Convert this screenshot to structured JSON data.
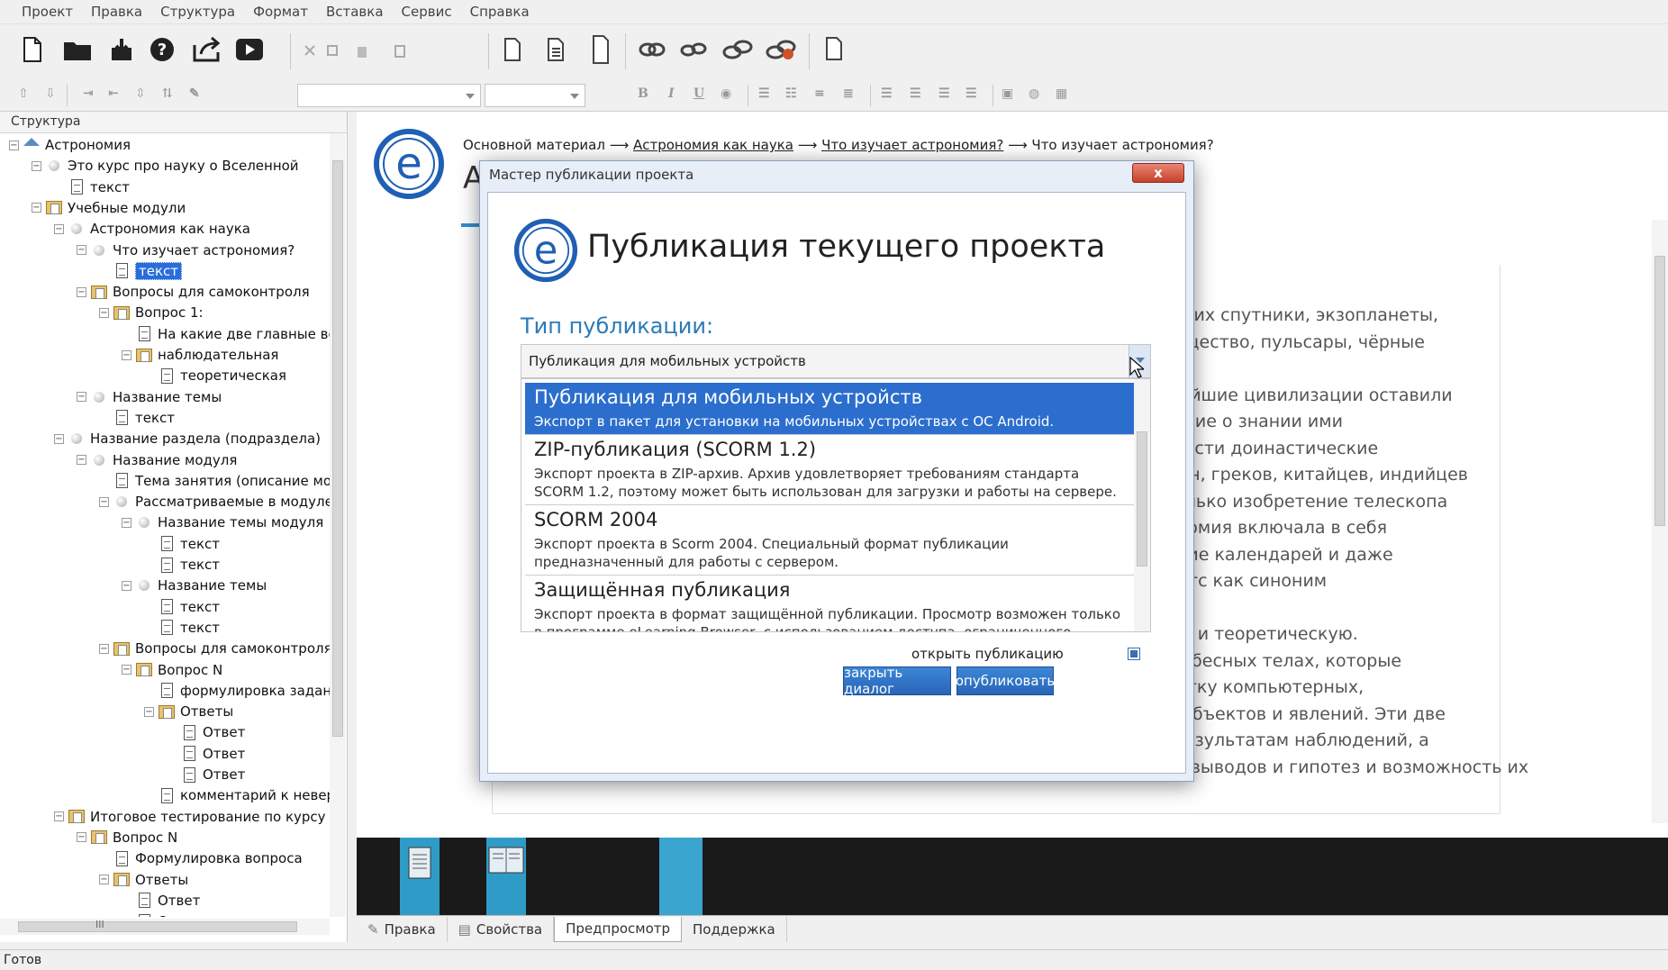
{
  "menu": [
    "Проект",
    "Правка",
    "Структура",
    "Формат",
    "Вставка",
    "Сервис",
    "Справка"
  ],
  "structure_panel": {
    "header": "Структура",
    "nodes": [
      {
        "label": "Астрономия",
        "depth": 0,
        "icon": "home-icon",
        "toggle": "−"
      },
      {
        "label": "Это курс про науку о Вселенной",
        "depth": 1,
        "icon": "circle-icon",
        "toggle": "−"
      },
      {
        "label": "текст",
        "depth": 2,
        "icon": "doc-icon",
        "toggle": ""
      },
      {
        "label": "Учебные модули",
        "depth": 1,
        "icon": "folder-icon",
        "toggle": "−"
      },
      {
        "label": "Астрономия как наука",
        "depth": 2,
        "icon": "circle-icon",
        "toggle": "−"
      },
      {
        "label": "Что изучает астрономия?",
        "depth": 3,
        "icon": "circle-icon",
        "toggle": "−"
      },
      {
        "label": "текст",
        "depth": 4,
        "icon": "doc-icon",
        "toggle": "",
        "selected": true
      },
      {
        "label": "Вопросы для самоконтроля",
        "depth": 3,
        "icon": "folder-icon",
        "toggle": "−"
      },
      {
        "label": "Вопрос 1:",
        "depth": 4,
        "icon": "folder-icon",
        "toggle": "−"
      },
      {
        "label": "На какие две главные ветв",
        "depth": 5,
        "icon": "doc-icon",
        "toggle": ""
      },
      {
        "label": "наблюдательная",
        "depth": 5,
        "icon": "folder-icon",
        "toggle": "−"
      },
      {
        "label": "теоретическая",
        "depth": 6,
        "icon": "doc-icon",
        "toggle": ""
      },
      {
        "label": "Название темы",
        "depth": 3,
        "icon": "circle-icon",
        "toggle": "−"
      },
      {
        "label": "текст",
        "depth": 4,
        "icon": "doc-icon",
        "toggle": ""
      },
      {
        "label": "Название раздела (подраздела)",
        "depth": 2,
        "icon": "circle-icon",
        "toggle": "−"
      },
      {
        "label": "Название модуля",
        "depth": 3,
        "icon": "circle-icon",
        "toggle": "−"
      },
      {
        "label": "Тема занятия (описание моду",
        "depth": 4,
        "icon": "doc-icon",
        "toggle": ""
      },
      {
        "label": "Рассматриваемые в модуле т",
        "depth": 4,
        "icon": "circle-icon",
        "toggle": "−"
      },
      {
        "label": "Название темы модуля",
        "depth": 5,
        "icon": "circle-icon",
        "toggle": "−"
      },
      {
        "label": "текст",
        "depth": 6,
        "icon": "doc-icon",
        "toggle": ""
      },
      {
        "label": "текст",
        "depth": 6,
        "icon": "doc-icon",
        "toggle": ""
      },
      {
        "label": "Название темы",
        "depth": 5,
        "icon": "circle-icon",
        "toggle": "−"
      },
      {
        "label": "текст",
        "depth": 6,
        "icon": "doc-icon",
        "toggle": ""
      },
      {
        "label": "текст",
        "depth": 6,
        "icon": "doc-icon",
        "toggle": ""
      },
      {
        "label": "Вопросы для самоконтроля",
        "depth": 4,
        "icon": "folder-icon",
        "toggle": "−"
      },
      {
        "label": "Вопрос N",
        "depth": 5,
        "icon": "folder-icon",
        "toggle": "−"
      },
      {
        "label": "формулировка задани",
        "depth": 6,
        "icon": "doc-icon",
        "toggle": ""
      },
      {
        "label": "Ответы",
        "depth": 6,
        "icon": "folder-icon",
        "toggle": "−"
      },
      {
        "label": "Ответ",
        "depth": 7,
        "icon": "doc-icon",
        "toggle": ""
      },
      {
        "label": "Ответ",
        "depth": 7,
        "icon": "doc-icon",
        "toggle": ""
      },
      {
        "label": "Ответ",
        "depth": 7,
        "icon": "doc-icon",
        "toggle": ""
      },
      {
        "label": "комментарий к неверн",
        "depth": 6,
        "icon": "doc-icon",
        "toggle": ""
      },
      {
        "label": "Итоговое тестирование по курсу",
        "depth": 2,
        "icon": "folder-icon",
        "toggle": "−"
      },
      {
        "label": "Вопрос N",
        "depth": 3,
        "icon": "folder-icon",
        "toggle": "−"
      },
      {
        "label": "Формулировка вопроса",
        "depth": 4,
        "icon": "doc-icon",
        "toggle": ""
      },
      {
        "label": "Ответы",
        "depth": 4,
        "icon": "folder-icon",
        "toggle": "−"
      },
      {
        "label": "Ответ",
        "depth": 5,
        "icon": "doc-icon",
        "toggle": ""
      },
      {
        "label": "Ответ",
        "depth": 5,
        "icon": "doc-icon",
        "toggle": ""
      }
    ],
    "hscroll_label": "III"
  },
  "main": {
    "breadcrumb": {
      "root": "Основной материал",
      "sep": "⟶",
      "link1": "Астрономия как наука",
      "link2": "Что изучает астрономия?",
      "current": "Что изучает астрономия?"
    },
    "title_letter": "А",
    "content_lines": [
      "темы и их спутники, экзопланеты,",
      "ное вещество, пульсары, чёрные",
      "",
      "древнейшие цивилизации оставили",
      "ствующие о знании ими",
      "о привести доинастические",
      "вилонян, греков, китайцев, индийцев",
      ". Но только изобретение телескопа",
      "астрономия включала в себя",
      "создание календарей и даже",
      "триваетс как синоним",
      "",
      "ельную и теоретическую.",
      "ых о небесных телах, которые",
      "азработку компьютерных,",
      "еских объектов и явлений. Эти две",
      "ения результатам наблюдений, а",
      "наблюдательная астрономия даёт материал для теоретических выводов и гипотез и возможность их"
    ]
  },
  "dialog": {
    "title": "Мастер публикации проекта",
    "close": "x",
    "heading": "Публикация текущего проекта",
    "type_label": "Тип публикации:",
    "selected_value": "Публикация для мобильных устройств",
    "options": [
      {
        "title": "Публикация для мобильных устройств",
        "desc": "Экспорт в пакет для установки на мобильных устройствах с ОС Android."
      },
      {
        "title": "ZIP-публикация (SCORM 1.2)",
        "desc": "Экспорт проекта в ZIP-архив. Архив удовлетворяет требованиям стандарта SCORM 1.2, поэтому может быть использован для загрузки и работы на сервере."
      },
      {
        "title": "SCORM 2004",
        "desc": "Экспорт проекта в Scorm 2004. Специальный формат публикации предназначенный для работы с сервером."
      },
      {
        "title": "Защищённая публикация",
        "desc": "Экспорт проекта в формат защищённой публикации. Просмотр возможен только в программе eLearning Browser, с использованием доступа, ограниченного паролем"
      }
    ],
    "open_label": "открыть публикацию",
    "open_checked": true,
    "btn_close": "закрыть диалог",
    "btn_publish": "опубликовать"
  },
  "tabs": [
    "Правка",
    "Свойства",
    "Предпросмотр",
    "Поддержка"
  ],
  "active_tab": "Предпросмотр",
  "status": "Готов",
  "colors": {
    "accent": "#2b6ecd",
    "brand_blue": "#1f5fb4",
    "page_thumb": "#2f9cc7"
  }
}
